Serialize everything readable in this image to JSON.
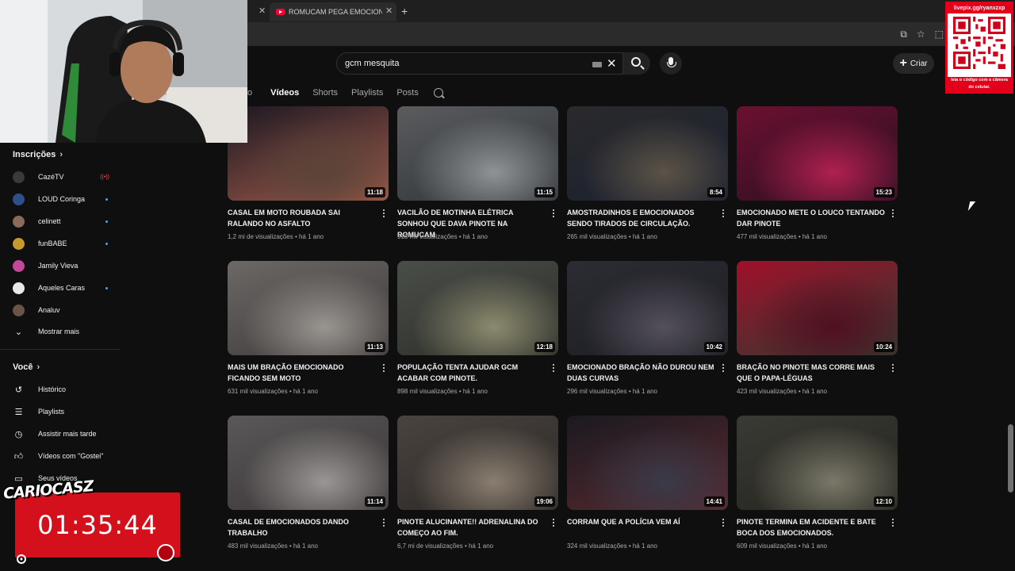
{
  "browser": {
    "active_tab_title": "ROMUCAM PEGA EMOCIONAD"
  },
  "header": {
    "search_query": "gcm mesquita",
    "create_label": "Criar"
  },
  "channel_tabs": {
    "partial_tab": "o",
    "tabs": [
      "Vídeos",
      "Shorts",
      "Playlists",
      "Posts"
    ]
  },
  "sidebar": {
    "subscriptions_title": "Inscrições",
    "subscriptions": [
      {
        "name": "CazéTV",
        "indicator": "live"
      },
      {
        "name": "LOUD Coringa",
        "indicator": "dot"
      },
      {
        "name": "celinett",
        "indicator": "dot"
      },
      {
        "name": "funBABE",
        "indicator": "dot"
      },
      {
        "name": "Jamily Vieva",
        "indicator": "none"
      },
      {
        "name": "Aqueles Caras",
        "indicator": "dot"
      },
      {
        "name": "Analuv",
        "indicator": "none"
      }
    ],
    "show_more": "Mostrar mais",
    "you_title": "Você",
    "you_items": [
      {
        "label": "Histórico",
        "icon": "history-icon"
      },
      {
        "label": "Playlists",
        "icon": "playlists-icon"
      },
      {
        "label": "Assistir mais tarde",
        "icon": "watch-later-icon"
      },
      {
        "label": "Vídeos com \"Gostei\"",
        "icon": "like-icon"
      },
      {
        "label": "Seus vídeos",
        "icon": "your-videos-icon"
      }
    ]
  },
  "videos": [
    {
      "title": "CASAL EM MOTO ROUBADA SAI RALANDO NO ASFALTO",
      "views": "1,2 mi de visualizações",
      "age": "há 1 ano",
      "duration": "11:18",
      "colors": [
        "#1c1822",
        "#5a4438",
        "#a05a4a"
      ]
    },
    {
      "title": "VACILÃO DE MOTINHA ELÉTRICA SONHOU QUE DAVA PINOTE NA ROMUCAM",
      "views": "918 mil visualizações",
      "age": "há 1 ano",
      "duration": "11:15",
      "colors": [
        "#5a5c5e",
        "#8f9396",
        "#2e3236"
      ]
    },
    {
      "title": "AMOSTRADINHOS E EMOCIONADOS SENDO TIRADOS DE CIRCULAÇÃO.",
      "views": "265 mil visualizações",
      "age": "há 1 ano",
      "duration": "8:54",
      "colors": [
        "#2a2a2c",
        "#5c5348",
        "#1a2030"
      ]
    },
    {
      "title": "EMOCIONADO METE O LOUCO TENTANDO DAR PINOTE",
      "views": "477 mil visualizações",
      "age": "há 1 ano",
      "duration": "15:23",
      "colors": [
        "#6a1030",
        "#b02050",
        "#2a1020"
      ]
    },
    {
      "title": "MAIS UM BRAÇÃO EMOCIONADO FICANDO SEM MOTO",
      "views": "631 mil visualizações",
      "age": "há 1 ano",
      "duration": "11:13",
      "colors": [
        "#6c6866",
        "#9a9590",
        "#3c3838"
      ]
    },
    {
      "title": "POPULAÇÃO TENTA AJUDAR GCM ACABAR COM PINOTE.",
      "views": "898 mil visualizações",
      "age": "há 1 ano",
      "duration": "12:18",
      "colors": [
        "#4a4e48",
        "#8c8a6e",
        "#2a2c28"
      ]
    },
    {
      "title": "EMOCIONADO BRAÇÃO NÃO DUROU NEM DUAS CURVAS",
      "views": "296 mil visualizações",
      "age": "há 1 ano",
      "duration": "10:42",
      "colors": [
        "#2c2c34",
        "#54505a",
        "#1c1c22"
      ]
    },
    {
      "title": "BRAÇÃO NO PINOTE MAS CORRE MAIS QUE O PAPA-LÉGUAS",
      "views": "423 mil visualizações",
      "age": "há 1 ano",
      "duration": "10:24",
      "colors": [
        "#a0102a",
        "#501020",
        "#303a30"
      ]
    },
    {
      "title": "CASAL DE EMOCIONADOS DANDO TRABALHO",
      "views": "483 mil visualizações",
      "age": "há 1 ano",
      "duration": "11:14",
      "colors": [
        "#5a5858",
        "#9a9694",
        "#3a3436"
      ]
    },
    {
      "title": "PINOTE ALUCINANTE!! ADRENALINA DO COMEÇO AO FIM.",
      "views": "6,7 mi de visualizações",
      "age": "há 1 ano",
      "duration": "19:06",
      "colors": [
        "#4a4440",
        "#8a7e70",
        "#2a2624"
      ]
    },
    {
      "title": "CORRAM QUE A POLÍCIA VEM AÍ",
      "views": "324 mil visualizações",
      "age": "há 1 ano",
      "duration": "14:41",
      "colors": [
        "#1a1a20",
        "#3a3a48",
        "#5a2a30"
      ]
    },
    {
      "title": "PINOTE TERMINA EM ACIDENTE E BATE BOCA DOS EMOCIONADOS.",
      "views": "609 mil visualizações",
      "age": "há 1 ano",
      "duration": "12:10",
      "colors": [
        "#3a3a34",
        "#7a7868",
        "#24241e"
      ]
    }
  ],
  "overlays": {
    "qr_top_text": "livepix.gg/ryanxzxp",
    "qr_bottom_text": "leia o código com a câmera do celular.",
    "timer": "01:35:44",
    "watermark": "CARIOCASZ"
  }
}
